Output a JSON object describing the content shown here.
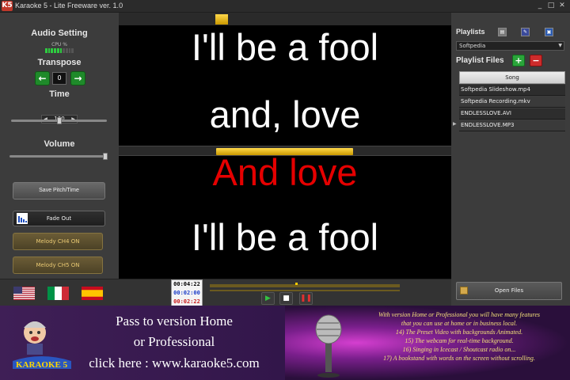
{
  "window": {
    "logo_text": "K5",
    "title": "Karaoke 5 - Lite Freeware ver. 1.0",
    "minimize": "_",
    "maximize": "□",
    "close": "✕"
  },
  "left_panel": {
    "audio_setting": "Audio Setting",
    "cpu_label": "CPU %",
    "cpu_level": 0.55,
    "transpose": "Transpose",
    "transpose_value": "0",
    "time": "Time",
    "time_value": "100",
    "time_slider_level": 0.5,
    "volume": "Volume",
    "volume_level": 0.98,
    "save_pitch_time": "Save Pitch/Time",
    "fade_out": "Fade Out",
    "melody_ch4": "Melody CH4 ON",
    "melody_ch5": "Melody CH5 ON"
  },
  "lyrics": {
    "lines": [
      "I'll be a fool",
      "and, love",
      "And love",
      "I'll be a fool"
    ],
    "active_index": 2,
    "colors": {
      "normal": "#ffffff",
      "active": "#e50000"
    }
  },
  "playlist": {
    "title": "Playlists",
    "selected": "Softpedia",
    "files_title": "Playlist Files",
    "add": "+",
    "remove": "−",
    "column": "Song",
    "songs": [
      "Softpedia Slideshow.mp4",
      "Softpedia Recording.mkv",
      "ENDLESSLOVE.AVI",
      "ENDLESSLOVE.MP3"
    ],
    "current_index": 3,
    "open_files": "Open Files"
  },
  "transport": {
    "times": [
      "00:04:22",
      "00:02:00",
      "00:02:22"
    ],
    "time_colors": [
      "#000000",
      "#1a3cc8",
      "#c81a1a"
    ],
    "seek_level": 0.45
  },
  "banner": {
    "promo_lines": [
      "Pass to version Home",
      "or Professional",
      "click here : www.karaoke5.com"
    ],
    "brand": "KARAOKE 5",
    "features": [
      "With version Home or Professional you will have many features",
      "that you can use at home or in business local.",
      "14) The Preset Video with backgrounds Animated.",
      "15)  The webcam for real-time background.",
      "16) Singing in Icecast / Shoutcast radio on...",
      "17)  A bookstand with words on the screen without scrolling."
    ]
  }
}
